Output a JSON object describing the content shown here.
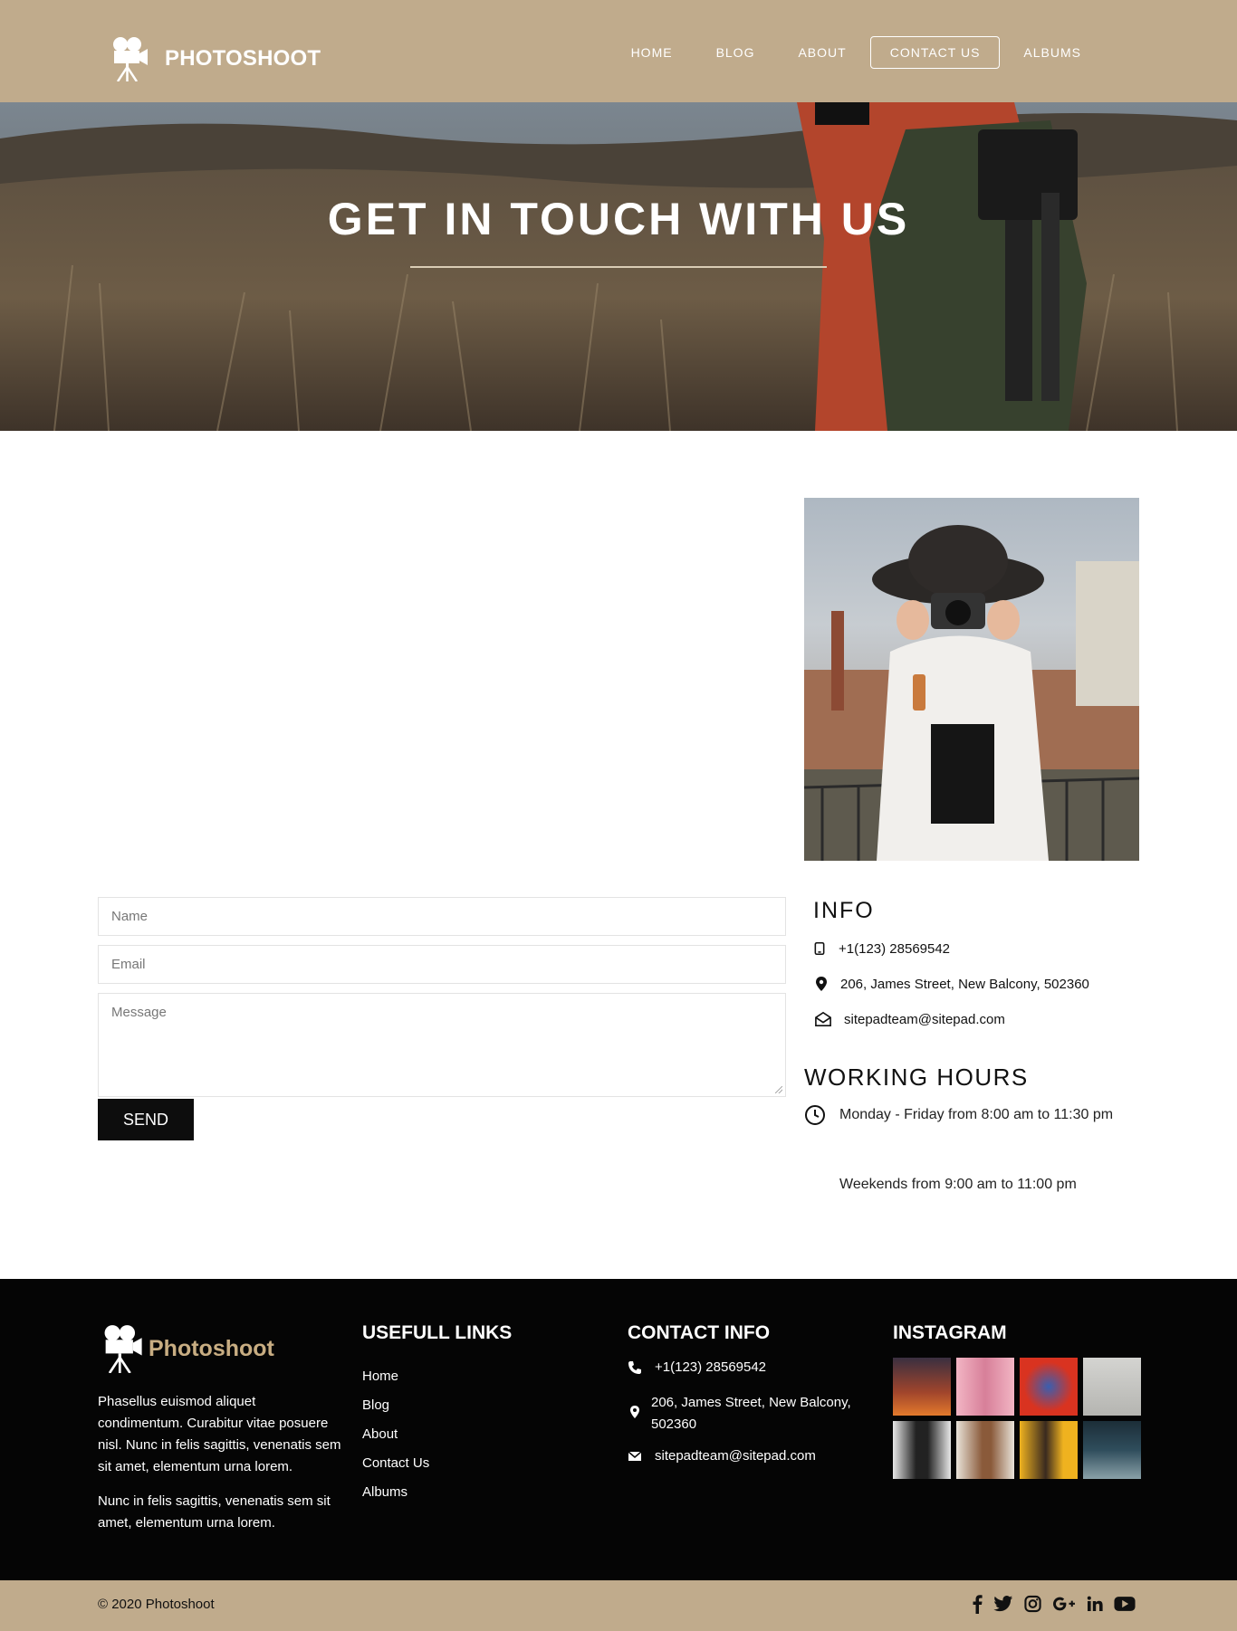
{
  "brand": {
    "name": "PHOTOSHOOT",
    "footer_name": "Photoshoot"
  },
  "nav": {
    "items": [
      {
        "label": "HOME"
      },
      {
        "label": "BLOG"
      },
      {
        "label": "ABOUT"
      },
      {
        "label": "CONTACT US",
        "active": true
      },
      {
        "label": "ALBUMS"
      }
    ]
  },
  "hero": {
    "title": "GET IN TOUCH WITH US"
  },
  "form": {
    "name_placeholder": "Name",
    "email_placeholder": "Email",
    "message_placeholder": "Message",
    "send_label": "SEND"
  },
  "info": {
    "title": "INFO",
    "phone": "+1(123) 28569542",
    "address": "206, James Street, New Balcony, 502360",
    "email": "sitepadteam@sitepad.com"
  },
  "working_hours": {
    "title": "WORKING HOURS",
    "weekdays": "Monday - Friday from 8:00 am to 11:30 pm",
    "weekends": "Weekends from 9:00 am to 11:00 pm"
  },
  "footer": {
    "about_p1": "Phasellus euismod aliquet condimentum. Curabitur vitae posuere nisl. Nunc in felis sagittis, venenatis sem sit amet, elementum urna lorem.",
    "about_p2": "Nunc in felis sagittis, venenatis sem sit amet, elementum urna lorem.",
    "links_title": "USEFULL LINKS",
    "links": [
      "Home",
      "Blog",
      "About",
      "Contact Us",
      "Albums"
    ],
    "contact_title": "CONTACT INFO",
    "contact_phone": "+1(123) 28569542",
    "contact_address": "206, James Street, New Balcony, 502360",
    "contact_email": "sitepadteam@sitepad.com",
    "instagram_title": "INSTAGRAM",
    "instagram_colors": [
      "#a1452c",
      "#e7a3b6",
      "#d93320",
      "#c9c9c6",
      "#3b3b3b",
      "#c7a07a",
      "#efb21f",
      "#2f4d5c"
    ],
    "copyright": "© 2020 Photoshoot",
    "social_icons": [
      "facebook-icon",
      "twitter-icon",
      "instagram-icon",
      "google-plus-icon",
      "linkedin-icon",
      "youtube-icon"
    ]
  },
  "colors": {
    "accent": "#c0ab8c",
    "footer_bg": "#050505",
    "footer_brand": "#c8ad82"
  }
}
